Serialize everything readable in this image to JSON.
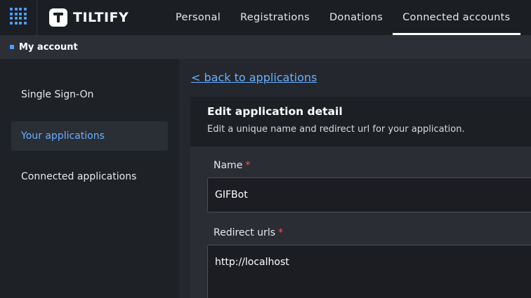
{
  "brand": {
    "name": "TILTIFY"
  },
  "nav": {
    "items": [
      {
        "label": "Personal"
      },
      {
        "label": "Registrations"
      },
      {
        "label": "Donations"
      },
      {
        "label": "Connected accounts",
        "active": true
      }
    ]
  },
  "subheader": {
    "title": "My account"
  },
  "sidebar": {
    "items": [
      {
        "label": "Single Sign-On"
      },
      {
        "label": "Your applications",
        "active": true
      },
      {
        "label": "Connected applications"
      }
    ]
  },
  "main": {
    "back_link": "< back to applications",
    "card": {
      "title": "Edit application detail",
      "description": "Edit a unique name and redirect url for your application.",
      "fields": {
        "name": {
          "label": "Name",
          "required_mark": "*",
          "value": "GIFBot"
        },
        "redirect": {
          "label": "Redirect urls",
          "required_mark": "*",
          "value": "http://localhost"
        }
      }
    }
  },
  "colors": {
    "accent": "#4aa0ff",
    "link": "#6ab0ff",
    "required": "#ff4d5a"
  }
}
